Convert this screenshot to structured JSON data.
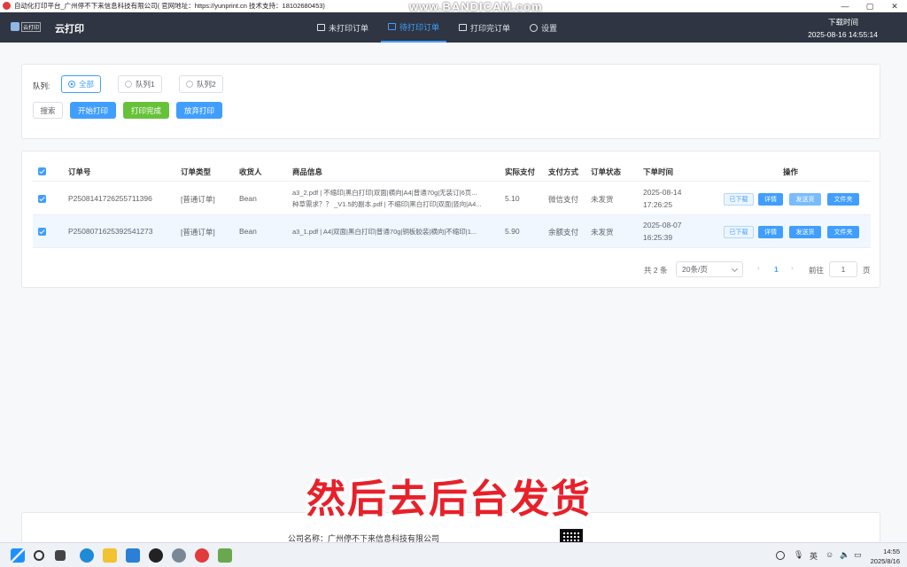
{
  "window": {
    "title": "自动化打印平台_广州停不下来信息科技有限公司( 官网地址：https://yunprint.cn 技术支持：18102680453)",
    "watermark": "www.BANDICAM.com",
    "controls": [
      "—",
      "▢",
      "✕"
    ]
  },
  "header": {
    "logo_text": "云打印",
    "app_name": "云打印",
    "nav": [
      {
        "label": "未打印订单",
        "icon": "printer-icon"
      },
      {
        "label": "待打印订单",
        "icon": "printer-icon",
        "active": true
      },
      {
        "label": "打印完订单",
        "icon": "printer-icon"
      },
      {
        "label": "设置",
        "icon": "gear-icon"
      }
    ],
    "download_time_label": "下载时间",
    "download_time": "2025-08-16 14:55:14"
  },
  "filter": {
    "queue_label": "队列:",
    "options": [
      {
        "label": "全部",
        "checked": true
      },
      {
        "label": "队列1",
        "checked": false
      },
      {
        "label": "队列2",
        "checked": false
      }
    ],
    "buttons": {
      "search": "搜索",
      "start_print": "开始打印",
      "print_done": "打印完成",
      "abandon_print": "放弃打印"
    }
  },
  "table": {
    "headers": [
      "订单号",
      "订单类型",
      "收货人",
      "商品信息",
      "实际支付",
      "支付方式",
      "订单状态",
      "下单时间",
      "操作"
    ],
    "rows": [
      {
        "order_no": "P2508141726255711396",
        "type": "[普通订单]",
        "receiver": "Bean",
        "goods_line1": "a3_2.pdf | 不缩印|黑白打印|双面|横向|A4|普通70g|无装订|6页...",
        "goods_line2": "种草需求？？ _V1.5的副本.pdf | 不缩印|黑白打印|双面|竖向|A4...",
        "paid": "5.10",
        "pay_method": "微信支付",
        "status": "未发货",
        "date": "2025-08-14",
        "time": "17:26:25",
        "actions": [
          "已下载",
          "详情",
          "发送货",
          "文件夹"
        ]
      },
      {
        "order_no": "P2508071625392541273",
        "type": "[普通订单]",
        "receiver": "Bean",
        "goods_line1": "a3_1.pdf | A4|双面|黑白打印|普通70g|铜板胶装|横向|不缩印|1...",
        "goods_line2": "",
        "paid": "5.90",
        "pay_method": "余额支付",
        "status": "未发货",
        "date": "2025-08-07",
        "time": "16:25:39",
        "actions": [
          "已下载",
          "详情",
          "发送货",
          "文件夹"
        ]
      }
    ]
  },
  "pagination": {
    "total": "共 2 条",
    "page_size": "20条/页",
    "prev": "‹",
    "current": "1",
    "next": "›",
    "goto_label": "前往",
    "goto_value": "1",
    "page_suffix": "页"
  },
  "footer": {
    "company": "公司名称：广州停不下来信息科技有限公司"
  },
  "subtitle": "然后去后台发货",
  "taskbar": {
    "tray_lang": "英",
    "clock_time": "14:55",
    "clock_date": "2025/8/16"
  },
  "colors": {
    "primary": "#409eff",
    "success": "#67c23a",
    "header_bg": "#2f3542",
    "subtitle": "#e8202a"
  }
}
